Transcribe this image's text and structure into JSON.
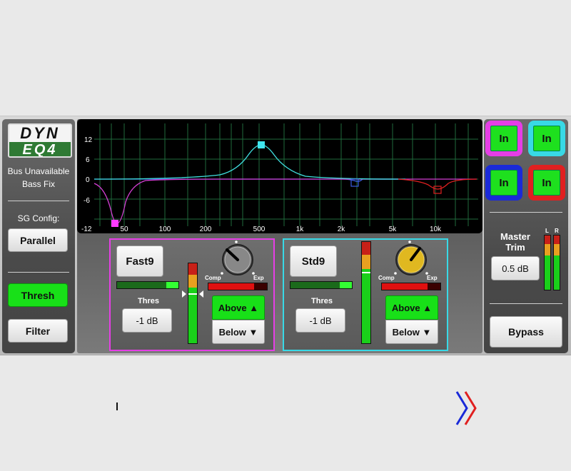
{
  "logo": {
    "top": "DYN",
    "bottom": "EQ4"
  },
  "left": {
    "status_line1": "Bus Unavailable",
    "status_line2": "Bass Fix",
    "sg_config_label": "SG Config:",
    "parallel_label": "Parallel",
    "thresh_label": "Thresh",
    "filter_label": "Filter"
  },
  "graph": {
    "y_ticks": [
      "12",
      "6",
      "0",
      "-6",
      "-12"
    ],
    "x_ticks": [
      "50",
      "100",
      "200",
      "500",
      "1k",
      "2k",
      "5k",
      "10k"
    ]
  },
  "bands": [
    {
      "name": "Fast9",
      "thres_label": "Thres",
      "thres_value": "-1 dB",
      "comp_label": "Comp",
      "exp_label": "Exp",
      "above_label": "Above",
      "below_label": "Below",
      "accent": "#e63ee6",
      "knob_color": "#888888"
    },
    {
      "name": "Std9",
      "thres_label": "Thres",
      "thres_value": "-1 dB",
      "comp_label": "Comp",
      "exp_label": "Exp",
      "above_label": "Above",
      "below_label": "Below",
      "accent": "#38d9e6",
      "knob_color": "#e0b820"
    }
  ],
  "right": {
    "in_buttons": [
      {
        "label": "In",
        "color": "#e63ee6"
      },
      {
        "label": "In",
        "color": "#38d9e6"
      },
      {
        "label": "In",
        "color": "#1a2ad8"
      },
      {
        "label": "In",
        "color": "#e02020"
      }
    ],
    "master_trim_line1": "Master",
    "master_trim_line2": "Trim",
    "master_trim_value": "0.5 dB",
    "meter_l": "L",
    "meter_r": "R",
    "bypass_label": "Bypass"
  }
}
